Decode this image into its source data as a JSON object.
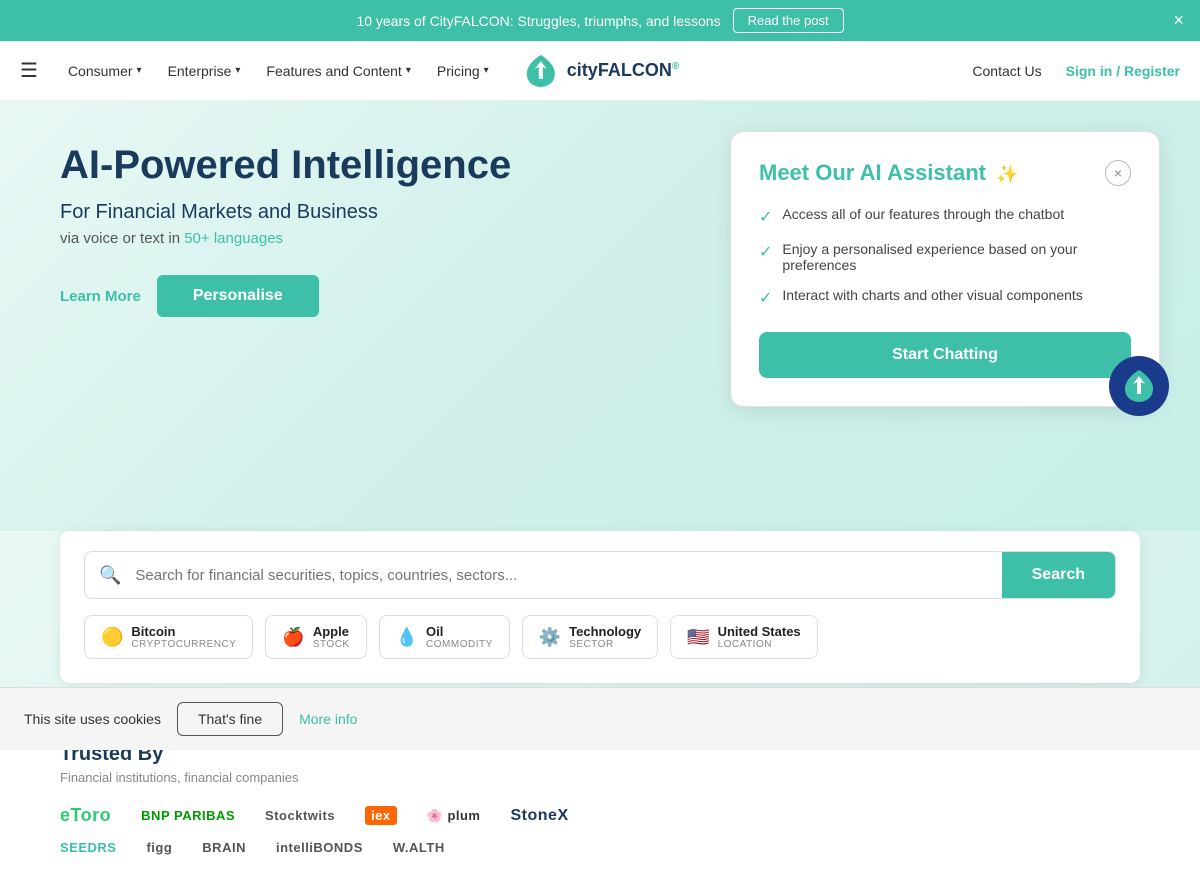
{
  "banner": {
    "text": "10 years of CityFALCON: Struggles, triumphs, and lessons",
    "read_post_label": "Read the post",
    "close_label": "×"
  },
  "navbar": {
    "menu_icon": "☰",
    "items": [
      {
        "label": "Consumer",
        "has_dropdown": true
      },
      {
        "label": "Enterprise",
        "has_dropdown": true
      },
      {
        "label": "Features and Content",
        "has_dropdown": true
      },
      {
        "label": "Pricing",
        "has_dropdown": true
      }
    ],
    "contact_label": "Contact Us",
    "sign_in_label": "Sign in / Register",
    "logo_city": "city",
    "logo_falcon": "FALCON"
  },
  "hero": {
    "title": "AI-Powered Intelligence",
    "subtitle": "For Financial Markets and Business",
    "sub2_text": "via voice or text in ",
    "sub2_link": "50+ languages",
    "learn_more_label": "Learn More",
    "personalise_label": "Personalise"
  },
  "search": {
    "placeholder": "Search for financial securities, topics, countries, sectors...",
    "button_label": "Search",
    "chips": [
      {
        "icon": "🟡",
        "name": "Bitcoin",
        "type": "CRYPTOCURRENCY"
      },
      {
        "icon": "🍎",
        "name": "Apple",
        "type": "STOCK"
      },
      {
        "icon": "💧",
        "name": "Oil",
        "type": "COMMODITY"
      },
      {
        "icon": "⚙️",
        "name": "Technology",
        "type": "SECTOR"
      },
      {
        "icon": "🇺🇸",
        "name": "United States",
        "type": "LOCATION"
      }
    ]
  },
  "ai_card": {
    "title_prefix": "Meet Our ",
    "title_highlight": "AI Assistant",
    "sparkle": "✨",
    "close_label": "×",
    "features": [
      "Access all of our features through the chatbot",
      "Enjoy a personalised experience based on your preferences",
      "Interact with charts and other visual components"
    ],
    "cta_label": "Start Chatting"
  },
  "trusted": {
    "title": "Trusted By",
    "subtitle": "Financial institutions, financial companies",
    "logos_row1": [
      "eToro",
      "BNP PARIBAS",
      "Stocktwits",
      "iex",
      "plum",
      "StoneX"
    ],
    "logos_row2": [
      "SEEDRS",
      "figg",
      "BRAIN",
      "intelliBONDS",
      "W.ALTH"
    ]
  },
  "cookie": {
    "text": "This site uses cookies",
    "accept_label": "That's fine",
    "more_info_label": "More info"
  }
}
